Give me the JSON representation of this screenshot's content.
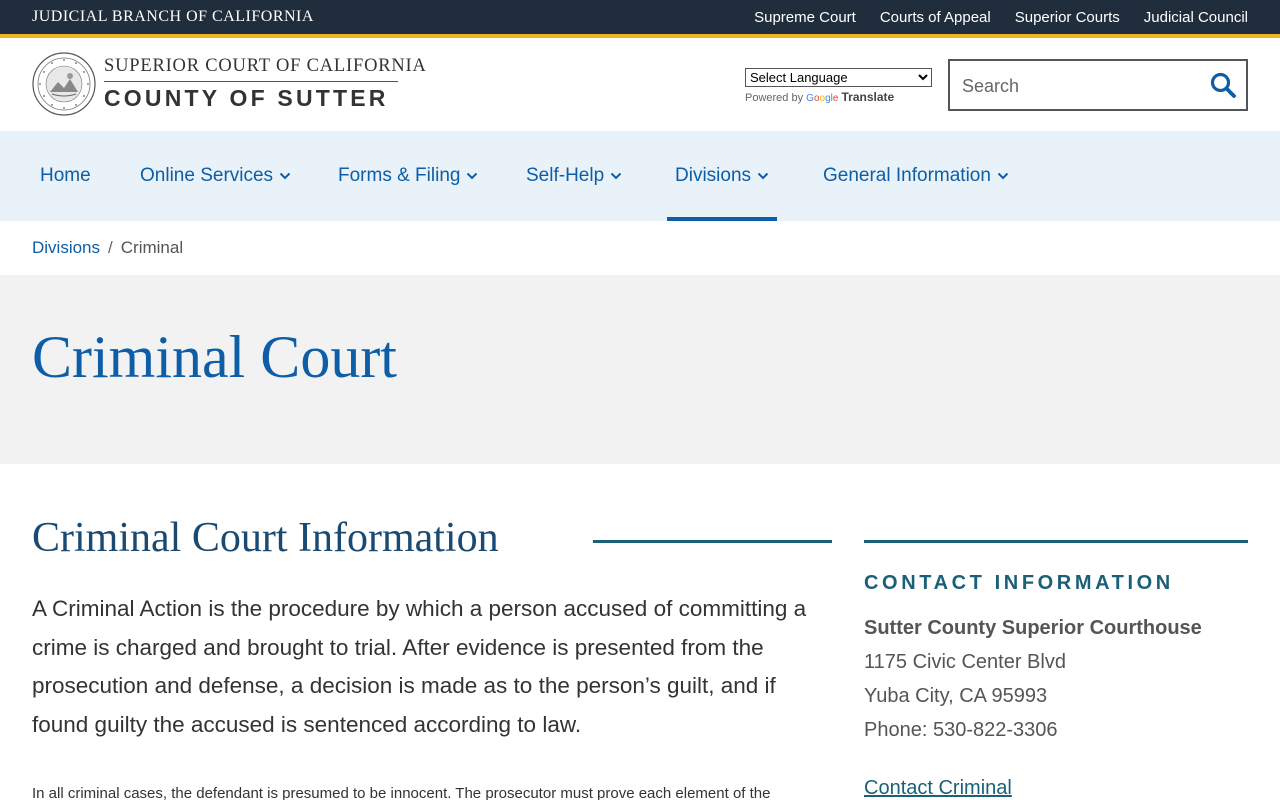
{
  "topbar": {
    "title": "JUDICIAL BRANCH OF CALIFORNIA",
    "links": [
      "Supreme Court",
      "Courts of Appeal",
      "Superior Courts",
      "Judicial Council"
    ],
    "accent_color": "#f0b323",
    "background_color": "#1f2d3d"
  },
  "header": {
    "court_line1": "SUPERIOR COURT OF CALIFORNIA",
    "court_line2": "COUNTY OF SUTTER",
    "seal_icon": "california-judicial-seal-icon",
    "language_select": "Select Language",
    "powered_by": "Powered by",
    "google": "Google",
    "translate": "Translate",
    "search_placeholder": "Search",
    "search_icon": "search-icon"
  },
  "nav": {
    "items": [
      {
        "label": "Home",
        "has_dropdown": false,
        "active": false
      },
      {
        "label": "Online Services",
        "has_dropdown": true,
        "active": false
      },
      {
        "label": "Forms & Filing",
        "has_dropdown": true,
        "active": false
      },
      {
        "label": "Self-Help",
        "has_dropdown": true,
        "active": false
      },
      {
        "label": "Divisions",
        "has_dropdown": true,
        "active": true
      },
      {
        "label": "General Information",
        "has_dropdown": true,
        "active": false
      }
    ],
    "background_color": "#e9f2f9",
    "link_color": "#0d5ea6"
  },
  "breadcrumb": {
    "parent": "Divisions",
    "separator": "/",
    "current": "Criminal"
  },
  "hero": {
    "title": "Criminal Court"
  },
  "main": {
    "section_title": "Criminal Court Information",
    "lead": "A Criminal Action is the procedure by which a person accused of committing a crime is charged and brought to trial. After evidence is presented from the prosecution and defense, a decision is made as to the person’s guilt, and if found guilty the accused is sentenced according to law.",
    "body": "In all criminal cases, the defendant is presumed to be innocent. The prosecutor must prove each element of the"
  },
  "sidebar": {
    "heading": "CONTACT INFORMATION",
    "name": "Sutter County Superior Courthouse",
    "address1": "1175 Civic Center Blvd",
    "address2": "Yuba City, CA 95993",
    "phone": "Phone: 530-822-3306",
    "contact_link": "Contact Criminal"
  }
}
